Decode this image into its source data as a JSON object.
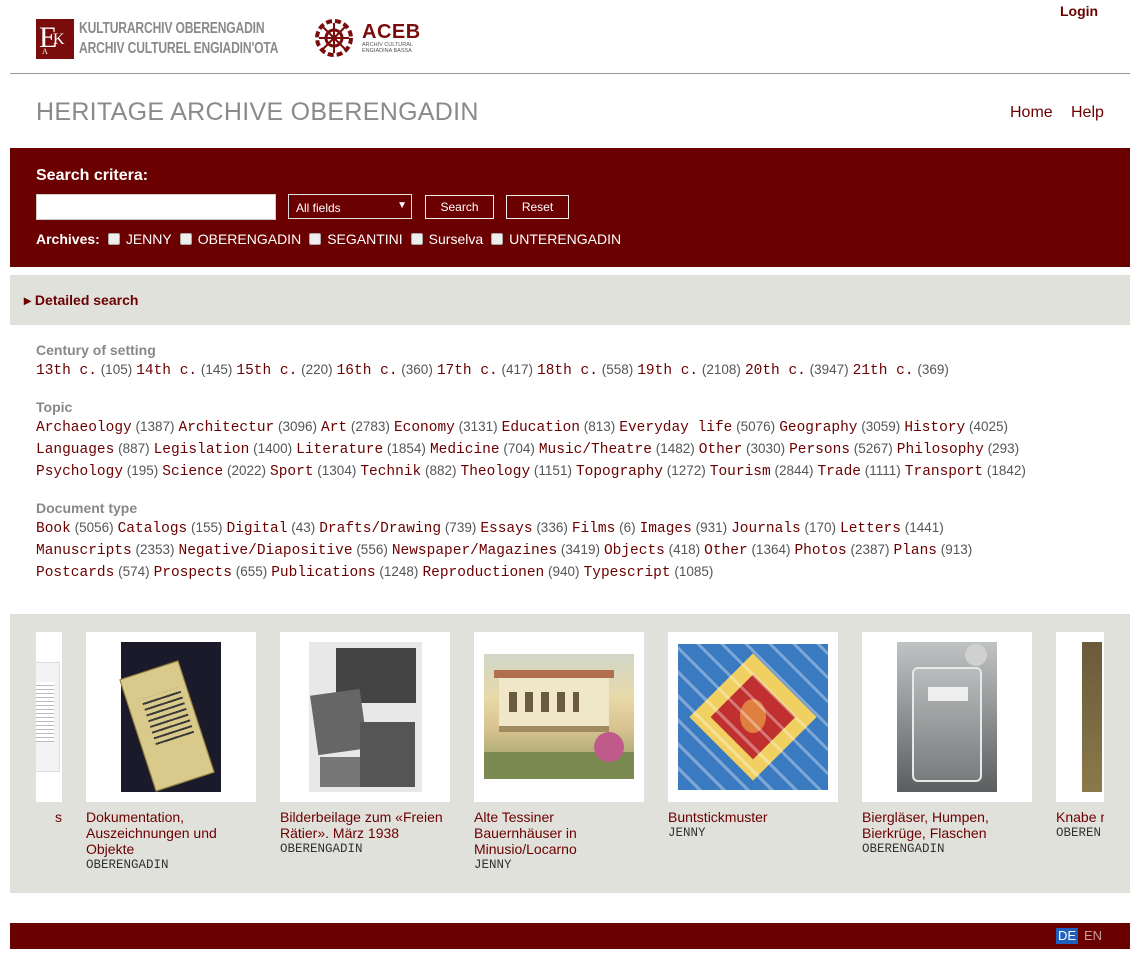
{
  "header": {
    "login": "Login",
    "logo_kao_lines": [
      "KULTURARCHIV OBERENGADIN",
      "ARCHIV CULTUREL ENGIADIN'OTA"
    ],
    "logo_aceb_title": "ACEB",
    "logo_aceb_sub": [
      "ARCHIV CULTURAL",
      "ENGIADINA BASSA"
    ],
    "site_title": "HERITAGE ARCHIVE OBERENGADIN",
    "nav": {
      "home": "Home",
      "help": "Help"
    }
  },
  "search": {
    "label": "Search critera:",
    "input_value": "",
    "field_selected": "All fields",
    "search_button": "Search",
    "reset_button": "Reset",
    "archives_label": "Archives:",
    "archives": [
      "JENNY",
      "OBERENGADIN",
      "SEGANTINI",
      "Surselva",
      "UNTERENGADIN"
    ]
  },
  "detailed_search": "▸ Detailed search",
  "facets": [
    {
      "title": "Century of setting",
      "lines": [
        [
          [
            "13th c.",
            "(105)"
          ],
          [
            "14th c.",
            "(145)"
          ],
          [
            "15th c.",
            "(220)"
          ],
          [
            "16th c.",
            "(360)"
          ],
          [
            "17th c.",
            "(417)"
          ],
          [
            "18th c.",
            "(558)"
          ],
          [
            "19th c.",
            "(2108)"
          ],
          [
            "20th c.",
            "(3947)"
          ],
          [
            "21th c.",
            "(369)"
          ]
        ]
      ]
    },
    {
      "title": "Topic",
      "lines": [
        [
          [
            "Archaeology",
            "(1387)"
          ],
          [
            "Architectur",
            "(3096)"
          ],
          [
            "Art",
            "(2783)"
          ],
          [
            "Economy",
            "(3131)"
          ],
          [
            "Education",
            "(813)"
          ],
          [
            "Everyday life",
            "(5076)"
          ],
          [
            "Geography",
            "(3059)"
          ],
          [
            "History",
            "(4025)"
          ]
        ],
        [
          [
            "Languages",
            "(887)"
          ],
          [
            "Legislation",
            "(1400)"
          ],
          [
            "Literature",
            "(1854)"
          ],
          [
            "Medicine",
            "(704)"
          ],
          [
            "Music/Theatre",
            "(1482)"
          ],
          [
            "Other",
            "(3030)"
          ],
          [
            "Persons",
            "(5267)"
          ],
          [
            "Philosophy",
            "(293)"
          ]
        ],
        [
          [
            "Psychology",
            "(195)"
          ],
          [
            "Science",
            "(2022)"
          ],
          [
            "Sport",
            "(1304)"
          ],
          [
            "Technik",
            "(882)"
          ],
          [
            "Theology",
            "(1151)"
          ],
          [
            "Topography",
            "(1272)"
          ],
          [
            "Tourism",
            "(2844)"
          ],
          [
            "Trade",
            "(1111)"
          ],
          [
            "Transport",
            "(1842)"
          ]
        ]
      ]
    },
    {
      "title": "Document type",
      "lines": [
        [
          [
            "Book",
            "(5056)"
          ],
          [
            "Catalogs",
            "(155)"
          ],
          [
            "Digital",
            "(43)"
          ],
          [
            "Drafts/Drawing",
            "(739)"
          ],
          [
            "Essays",
            "(336)"
          ],
          [
            "Films",
            "(6)"
          ],
          [
            "Images",
            "(931)"
          ],
          [
            "Journals",
            "(170)"
          ],
          [
            "Letters",
            "(1441)"
          ]
        ],
        [
          [
            "Manuscripts",
            "(2353)"
          ],
          [
            "Negative/Diapositive",
            "(556)"
          ],
          [
            "Newspaper/Magazines",
            "(3419)"
          ],
          [
            "Objects",
            "(418)"
          ],
          [
            "Other",
            "(1364)"
          ],
          [
            "Photos",
            "(2387)"
          ],
          [
            "Plans",
            "(913)"
          ]
        ],
        [
          [
            "Postcards",
            "(574)"
          ],
          [
            "Prospects",
            "(655)"
          ],
          [
            "Publications",
            "(1248)"
          ],
          [
            "Reproductionen",
            "(940)"
          ],
          [
            "Typescript",
            "(1085)"
          ]
        ]
      ]
    }
  ],
  "carousel": [
    {
      "title": "s",
      "archive": "",
      "image": "partial-document"
    },
    {
      "title": "Dokumentation, Auszeichnungen und Objekte",
      "archive": "OBERENGADIN",
      "image": "book-with-ribbon"
    },
    {
      "title": "Bilderbeilage zum «Freien Rätier». März 1938",
      "archive": "OBERENGADIN",
      "image": "photo-collage"
    },
    {
      "title": "Alte Tessiner Bauernhäuser in Minusio/Locarno",
      "archive": "JENNY",
      "image": "watercolor-houses"
    },
    {
      "title": "Buntstickmuster",
      "archive": "JENNY",
      "image": "embroidery-pattern"
    },
    {
      "title": "Biergläser, Humpen, Bierkrüge, Flaschen",
      "archive": "OBERENGADIN",
      "image": "beer-glasses"
    },
    {
      "title": "Knabe m",
      "archive": "OBEREN",
      "image": "partial-painting"
    }
  ],
  "footer": {
    "lang_de": "DE",
    "lang_en": "EN"
  },
  "colors": {
    "brand": "#6b0000",
    "panel": "#e1e1dc"
  }
}
